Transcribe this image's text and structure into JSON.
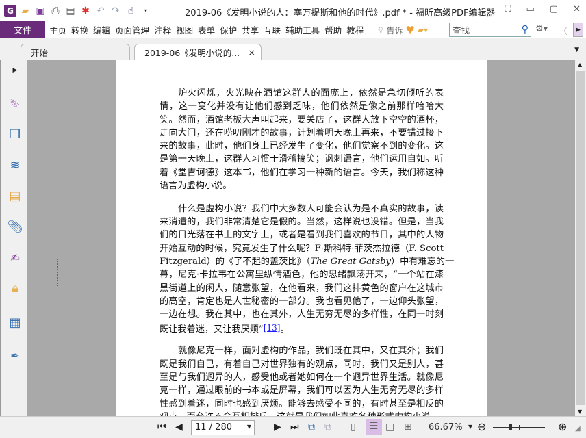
{
  "app": {
    "title": "2019-06《发明小说的人：塞万提斯和他的时代》.pdf * - 福昕高级PDF编辑器"
  },
  "menu": {
    "file": "文件",
    "items": [
      "主页",
      "转换",
      "编辑",
      "页面管理",
      "注释",
      "视图",
      "表单",
      "保护",
      "共享",
      "互联",
      "辅助工具",
      "帮助",
      "教程"
    ],
    "tell_me": "告诉",
    "search_placeholder": "查找"
  },
  "tabs": [
    {
      "label": "开始"
    },
    {
      "label": "2019-06《发明小说的...",
      "close": "×"
    }
  ],
  "colors": {
    "accent": "#6a2c7a",
    "link": "#1a1aff"
  },
  "document": {
    "paragraphs": [
      {
        "lines": [
          "炉火闪烁，火光映在酒馆这群人的面庞上，依然是急切倾听的表",
          "情，这一变化并没有让他们感到乏味，他们依然是像之前那样哈哈大",
          "笑。然而，酒馆老板大声叫起来，要关店了，这群人放下空空的酒杯，",
          "走向大门，还在唠叨刚才的故事，计划着明天晚上再来，不要错过接下",
          "来的故事，此时，他们身上已经发生了变化，他们觉察不到的变化。这",
          "是第一天晚上，这群人习惯于滑稽搞笑；讽刺语言，他们运用自如。听",
          "着《堂吉诃德》这本书，他们在学习一种新的语言。今天，我们称这种",
          "语言为虚构小说。"
        ]
      },
      {
        "lines": [
          "什么是虚构小说？我们中大多数人可能会认为是不真实的故事，读",
          "来消遣的，我们非常清楚它是假的。当然，这样说也没错。但是，当我",
          "们的目光落在书上的文字上，或者是看到我们喜欢的节目，其中的人物",
          "开始互动的时候，究竟发生了什么呢？F·斯科特·菲茨杰拉德（F.  Scott",
          [
            {
              "t": "Fitzgerald）的《了不起的盖茨比》（"
            },
            {
              "t": "The  Great  Gatsby",
              "i": true
            },
            {
              "t": "）中有难忘的一"
            }
          ],
          "幕，尼克·卡拉韦在公寓里纵情酒色，他的思绪飘荡开来，“一个站在漆",
          "黑街道上的闲人，随意张望，在他看来，我们这排黄色的窗户在这城市",
          "的高空，肯定也是人世秘密的一部分。我也看见他了，一边仰头张望，",
          "一边在想。我在其中，也在其外，人生无穷无尽的多样性，在同一时刻",
          [
            {
              "t": "既让我着迷，又让我厌烦”"
            },
            {
              "t": "[13]",
              "link": true
            },
            {
              "t": "。"
            }
          ]
        ]
      },
      {
        "lines": [
          "就像尼克一样，面对虚构的作品，我们既在其中，又在其外；我们",
          "既是我们自己，有着自己对世界独有的观点，同时，我们又是别人，甚",
          "至是与我们迥异的人，感受他或者她如何在一个迥异世界生活。就像尼",
          "克一样，通过眼前的书本或是屏幕，我们可以因为人生无穷无尽的多样",
          "性感到着迷，同时也感到厌烦。能够去感受不同的，有时甚至是相反的",
          "观点，而允许不会互相排斥，这就是我们如此喜欢各种形式虚构小说"
        ]
      }
    ]
  },
  "statusbar": {
    "page_input": "11 / 280",
    "zoom": "66.67%"
  }
}
